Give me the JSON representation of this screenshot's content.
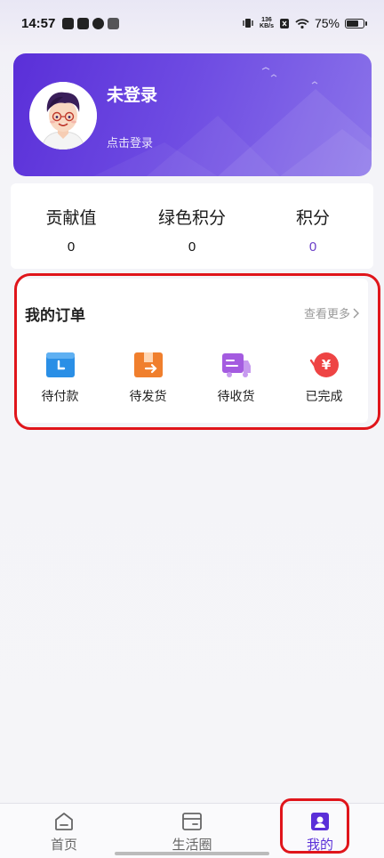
{
  "status_bar": {
    "time": "14:57",
    "net_speed_value": "136",
    "net_speed_unit": "KB/s",
    "battery_text": "75%",
    "battery_level": 0.75
  },
  "profile": {
    "name": "未登录",
    "login_hint": "点击登录"
  },
  "stats": [
    {
      "label": "贡献值",
      "value": "0"
    },
    {
      "label": "绿色积分",
      "value": "0"
    },
    {
      "label": "积分",
      "value": "0"
    }
  ],
  "orders": {
    "title": "我的订单",
    "more_label": "查看更多",
    "items": [
      {
        "label": "待付款",
        "icon": "wallet-clock-icon",
        "color": "#2a8fe6"
      },
      {
        "label": "待发货",
        "icon": "box-ship-icon",
        "color": "#f07f2d"
      },
      {
        "label": "待收货",
        "icon": "truck-icon",
        "color": "#a45be0"
      },
      {
        "label": "已完成",
        "icon": "yen-check-icon",
        "color": "#ee4444"
      }
    ]
  },
  "tabs": [
    {
      "label": "首页",
      "icon": "home-icon"
    },
    {
      "label": "生活圈",
      "icon": "card-icon"
    },
    {
      "label": "我的",
      "icon": "person-icon"
    }
  ],
  "colors": {
    "brand": "#5a2fd8",
    "highlight": "#e0151b"
  }
}
